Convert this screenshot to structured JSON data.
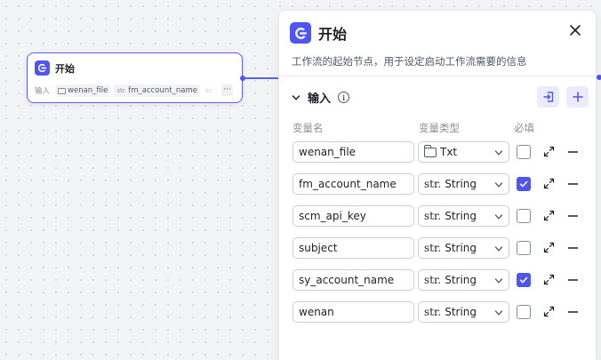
{
  "node": {
    "title": "开始",
    "inputs_label": "输入",
    "chips": [
      {
        "type_label": "",
        "name": "wenan_file",
        "icon": "folder-icon"
      },
      {
        "type_label": "str.",
        "name": "fm_account_name",
        "icon": "string-type-icon"
      }
    ],
    "more_label": "···",
    "fade_label": "sc"
  },
  "panel": {
    "title": "开始",
    "description": "工作流的起始节点，用于设定启动工作流需要的信息",
    "section_title": "输入",
    "columns": {
      "name": "变量名",
      "type": "变量类型",
      "required": "必填"
    },
    "variables": [
      {
        "name": "wenan_file",
        "type_prefix": "",
        "type": "Txt",
        "type_icon": "folder-icon",
        "required": false
      },
      {
        "name": "fm_account_name",
        "type_prefix": "str.",
        "type": "String",
        "type_icon": "",
        "required": true
      },
      {
        "name": "scm_api_key",
        "type_prefix": "str.",
        "type": "String",
        "type_icon": "",
        "required": false
      },
      {
        "name": "subject",
        "type_prefix": "str.",
        "type": "String",
        "type_icon": "",
        "required": false
      },
      {
        "name": "sy_account_name",
        "type_prefix": "str.",
        "type": "String",
        "type_icon": "",
        "required": true
      },
      {
        "name": "wenan",
        "type_prefix": "str.",
        "type": "String",
        "type_icon": "",
        "required": false
      }
    ]
  },
  "colors": {
    "accent": "#4e55f1",
    "accent_light": "#eaebfd",
    "border": "#c9cdd4",
    "canvas": "#f2f3f5"
  }
}
